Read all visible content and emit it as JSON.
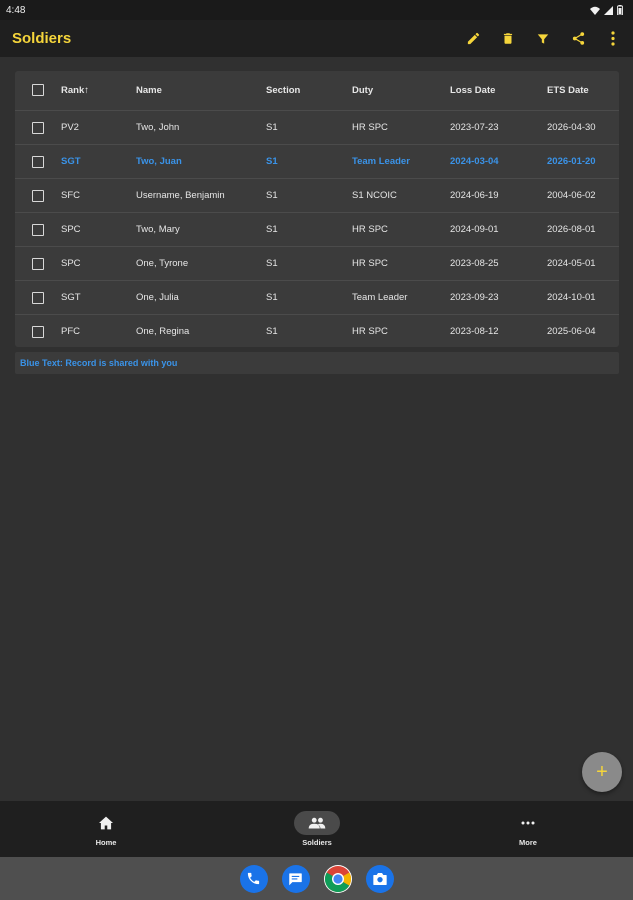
{
  "status_bar": {
    "time": "4:48"
  },
  "app_bar": {
    "title": "Soldiers",
    "actions": [
      "edit-icon",
      "delete-icon",
      "filter-icon",
      "share-icon",
      "more-vert-icon"
    ]
  },
  "table": {
    "headers": {
      "rank": "Rank",
      "name": "Name",
      "section": "Section",
      "duty": "Duty",
      "loss_date": "Loss Date",
      "ets_date": "ETS Date"
    },
    "sort_indicator": "↑",
    "rows": [
      {
        "rank": "PV2",
        "name": "Two, John",
        "section": "S1",
        "duty": "HR SPC",
        "loss_date": "2023-07-23",
        "ets_date": "2026-04-30",
        "shared": false
      },
      {
        "rank": "SGT",
        "name": "Two, Juan",
        "section": "S1",
        "duty": "Team Leader",
        "loss_date": "2024-03-04",
        "ets_date": "2026-01-20",
        "shared": true
      },
      {
        "rank": "SFC",
        "name": "Username, Benjamin",
        "section": "S1",
        "duty": "S1 NCOIC",
        "loss_date": "2024-06-19",
        "ets_date": "2004-06-02",
        "shared": false
      },
      {
        "rank": "SPC",
        "name": "Two, Mary",
        "section": "S1",
        "duty": "HR SPC",
        "loss_date": "2024-09-01",
        "ets_date": "2026-08-01",
        "shared": false
      },
      {
        "rank": "SPC",
        "name": "One, Tyrone",
        "section": "S1",
        "duty": "HR SPC",
        "loss_date": "2023-08-25",
        "ets_date": "2024-05-01",
        "shared": false
      },
      {
        "rank": "SGT",
        "name": "One, Julia",
        "section": "S1",
        "duty": "Team Leader",
        "loss_date": "2023-09-23",
        "ets_date": "2024-10-01",
        "shared": false
      },
      {
        "rank": "PFC",
        "name": "One, Regina",
        "section": "S1",
        "duty": "HR SPC",
        "loss_date": "2023-08-12",
        "ets_date": "2025-06-04",
        "shared": false
      }
    ]
  },
  "legend": {
    "text": "Blue Text: Record is shared with you"
  },
  "fab": {
    "icon": "plus-icon",
    "label": "+"
  },
  "bottom_nav": {
    "items": [
      {
        "label": "Home",
        "icon": "home-icon",
        "active": false
      },
      {
        "label": "Soldiers",
        "icon": "people-icon",
        "active": true
      },
      {
        "label": "More",
        "icon": "more-horiz-icon",
        "active": false
      }
    ]
  },
  "dock": {
    "apps": [
      "phone-icon",
      "messages-icon",
      "chrome-icon",
      "camera-icon"
    ]
  },
  "colors": {
    "accent": "#f5d53b",
    "shared_text": "#3a93e8",
    "background": "#303030",
    "surface": "#3b3b3b",
    "bar": "#1f1f1f"
  }
}
